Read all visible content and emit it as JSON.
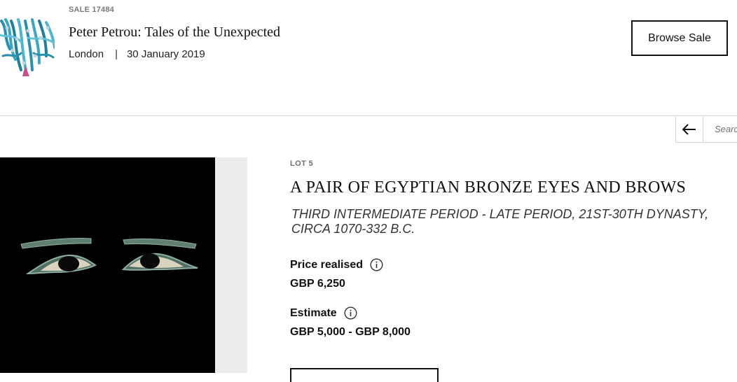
{
  "sale": {
    "number": "SALE 17484",
    "title": "Peter Petrou: Tales of the Unexpected",
    "location": "London",
    "separator": "|",
    "date": "30 January 2019",
    "browse_label": "Browse Sale"
  },
  "nav": {
    "back_icon": "arrow-left-icon",
    "search_placeholder": "Search"
  },
  "lot": {
    "number": "LOT 5",
    "title": "A PAIR OF EGYPTIAN BRONZE EYES AND BROWS",
    "subtitle_line1": "THIRD INTERMEDIATE PERIOD - LATE PERIOD, 21ST-30TH DYNASTY,",
    "subtitle_line2": "CIRCA 1070-332 B.C.",
    "price_label": "Price realised",
    "price_value": "GBP 6,250",
    "estimate_label": "Estimate",
    "estimate_value": "GBP 5,000 - GBP 8,000",
    "info_icon": "info-icon"
  },
  "colors": {
    "text": "#111111",
    "muted": "#7a7a7a",
    "divider": "#d6d6d6",
    "image_bg": "#000000",
    "patina": "#6f8f7f"
  }
}
